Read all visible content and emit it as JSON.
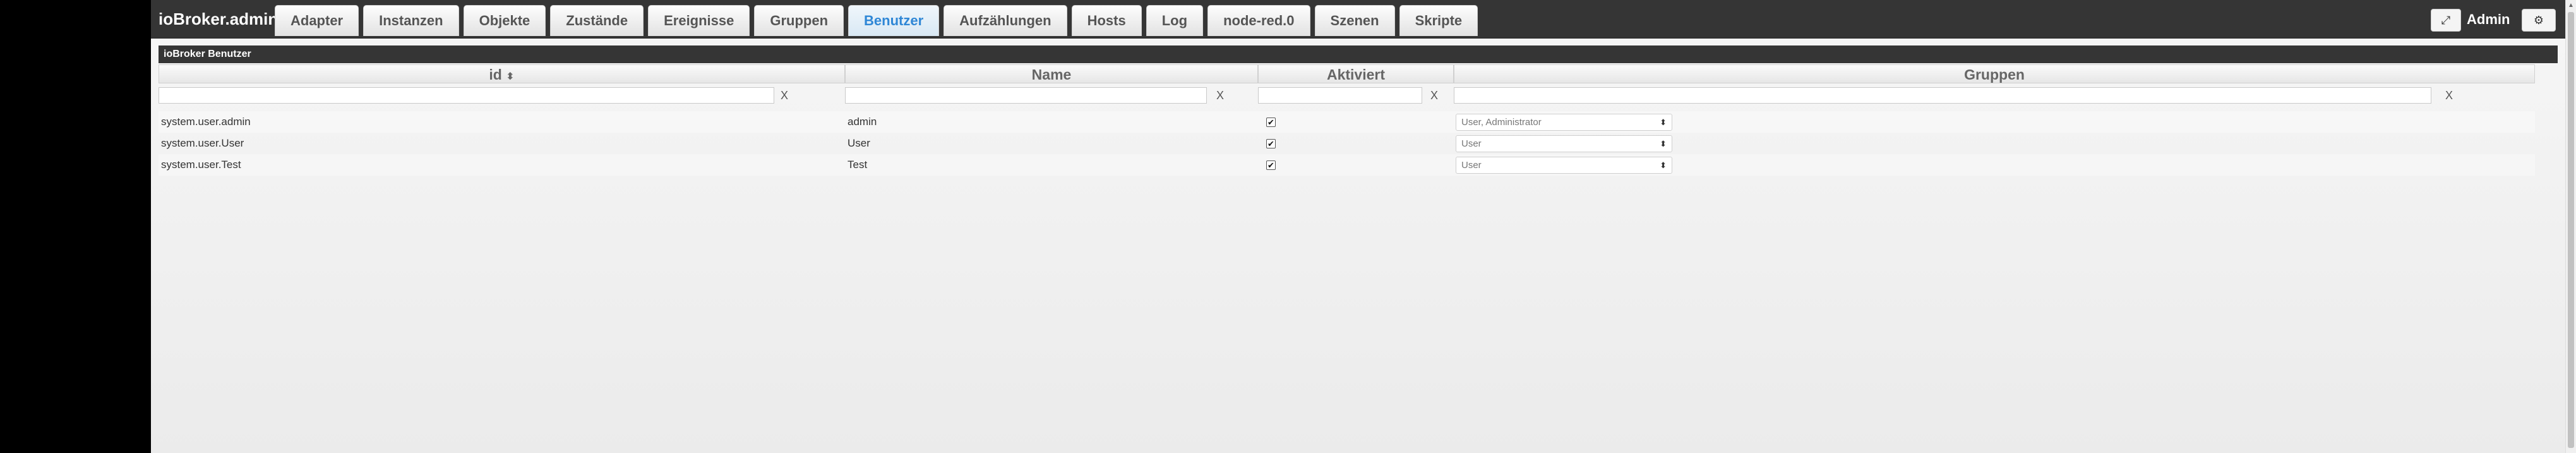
{
  "header": {
    "brand": "ioBroker.admin",
    "tabs": [
      {
        "label": "Adapter",
        "active": false
      },
      {
        "label": "Instanzen",
        "active": false
      },
      {
        "label": "Objekte",
        "active": false
      },
      {
        "label": "Zustände",
        "active": false
      },
      {
        "label": "Ereignisse",
        "active": false
      },
      {
        "label": "Gruppen",
        "active": false
      },
      {
        "label": "Benutzer",
        "active": true
      },
      {
        "label": "Aufzählungen",
        "active": false
      },
      {
        "label": "Hosts",
        "active": false
      },
      {
        "label": "Log",
        "active": false
      },
      {
        "label": "node-red.0",
        "active": false
      },
      {
        "label": "Szenen",
        "active": false
      },
      {
        "label": "Skripte",
        "active": false
      }
    ],
    "expand_icon": "expand-icon",
    "user": "Admin",
    "settings_icon": "gear-icon"
  },
  "panel": {
    "title": "ioBroker Benutzer"
  },
  "table": {
    "columns": {
      "id": "id",
      "sort_indicator": "⬍",
      "name": "Name",
      "enabled": "Aktiviert",
      "groups": "Gruppen"
    },
    "filter_clear": "X",
    "rows": [
      {
        "id": "system.user.admin",
        "name": "admin",
        "enabled": true,
        "groups": "User, Administrator"
      },
      {
        "id": "system.user.User",
        "name": "User",
        "enabled": true,
        "groups": "User"
      },
      {
        "id": "system.user.Test",
        "name": "Test",
        "enabled": true,
        "groups": "User"
      }
    ]
  },
  "colors": {
    "active_tab": "#2f87d6",
    "topbar": "#353535"
  }
}
